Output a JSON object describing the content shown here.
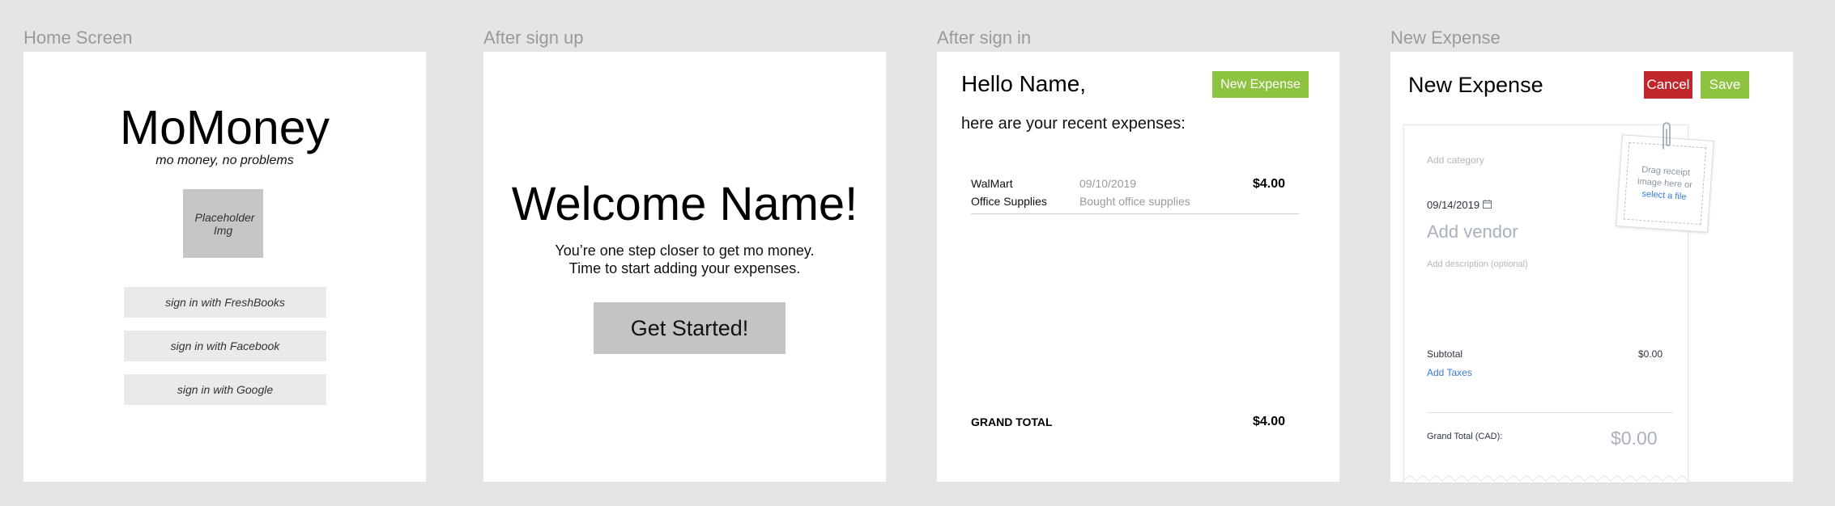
{
  "frames": {
    "home": {
      "label": "Home Screen",
      "title": "MoMoney",
      "tagline": "mo money, no problems",
      "placeholder_img": "Placeholder Img",
      "buttons": [
        "sign in with FreshBooks",
        "sign in with Facebook",
        "sign in with Google"
      ]
    },
    "after_signup": {
      "label": "After sign up",
      "title": "Welcome Name!",
      "line1": "You’re one step closer to get mo money.",
      "line2": "Time to start adding your expenses.",
      "cta": "Get Started!"
    },
    "after_signin": {
      "label": "After sign in",
      "greeting": "Hello Name,",
      "new_expense_button": "New Expense",
      "subtitle": "here are your recent expenses:",
      "expense": {
        "vendor": "WalMart",
        "category": "Office Supplies",
        "date": "09/10/2019",
        "description": "Bought office supplies",
        "amount": "$4.00"
      },
      "grand_total_label": "GRAND TOTAL",
      "grand_total_value": "$4.00"
    },
    "new_expense": {
      "label": "New Expense",
      "title": "New Expense",
      "cancel": "Cancel",
      "save": "Save",
      "add_category": "Add category",
      "date": "09/14/2019",
      "add_vendor": "Add vendor",
      "add_description": "Add description (optional)",
      "drag_receipt_1": "Drag receipt",
      "drag_receipt_2": "image here or",
      "select_file": "select a file",
      "subtotal_label": "Subtotal",
      "subtotal_value": "$0.00",
      "add_taxes": "Add Taxes",
      "grand_total_label": "Grand Total (CAD):",
      "grand_total_value": "$0.00"
    }
  },
  "colors": {
    "canvas": "#e5e5e5",
    "green": "#8dc340",
    "red": "#c0272d",
    "link_blue": "#3a7bd5"
  },
  "icons": {
    "calendar": "calendar-icon",
    "paperclip": "paperclip-icon"
  }
}
